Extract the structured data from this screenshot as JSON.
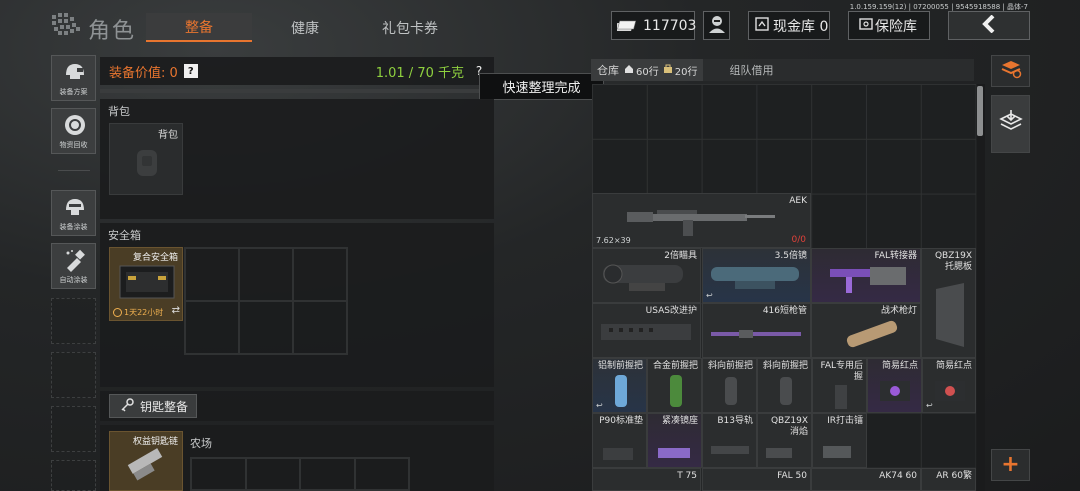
{
  "top": {
    "title": "角色",
    "tabs": [
      "整备",
      "健康",
      "礼包卡券"
    ],
    "version": "1.0.159.159(12) | 07200055 | 9545918588 | 晶体-7",
    "money": "117703",
    "cash_vault": "现金库 0",
    "safe_vault": "保险库"
  },
  "left_tools": [
    {
      "label": "装备方案",
      "icon": "helmet-icon"
    },
    {
      "label": "物资回收",
      "icon": "recycle-icon"
    },
    {
      "label": "装备涂装",
      "icon": "paint-helmet-icon"
    },
    {
      "label": "自动涂装",
      "icon": "spray-icon"
    }
  ],
  "equip": {
    "value_label": "装备价值: 0",
    "help": "?",
    "weight": "1.01 / 70 千克",
    "toast": "快速整理完成",
    "backpack_section": "背包",
    "backpack_slot": "背包",
    "safebox_section": "安全箱",
    "safebox_name": "复合安全箱",
    "safebox_timer": "1天22小时",
    "key_button": "钥匙整备",
    "key_item": "权益钥匙链",
    "key_area": "农场"
  },
  "inventory": {
    "tab_warehouse": "仓库",
    "rows_a": "60行",
    "rows_b": "20行",
    "tab_team": "组队借用",
    "items": [
      {
        "name": "AEK",
        "corner": "7.62×39",
        "ammo": "0/0"
      },
      {
        "name": "2倍瞄具"
      },
      {
        "name": "3.5倍镜"
      },
      {
        "name": "FAL转接器"
      },
      {
        "name": "QBZ19X\n托腮板"
      },
      {
        "name": "USAS改进护"
      },
      {
        "name": "416短枪管"
      },
      {
        "name": "战术枪灯"
      },
      {
        "name": "铝制前握把"
      },
      {
        "name": "合金前握把"
      },
      {
        "name": "斜向前握把"
      },
      {
        "name": "斜向前握把"
      },
      {
        "name": "FAL专用后\n握"
      },
      {
        "name": "简易红点"
      },
      {
        "name": "简易红点"
      },
      {
        "name": "P90标准垫"
      },
      {
        "name": "紧凑镜座"
      },
      {
        "name": "B13导轨"
      },
      {
        "name": "QBZ19X\n消焰"
      },
      {
        "name": "IR打击镭"
      },
      {
        "name": "T 75"
      },
      {
        "name": "FAL 50"
      },
      {
        "name": "AK74 60"
      },
      {
        "name": "AR 60繁"
      }
    ]
  },
  "colors": {
    "accent": "#e8752f",
    "weight_green": "#8fd13f",
    "ammo_red": "#e0413a"
  }
}
